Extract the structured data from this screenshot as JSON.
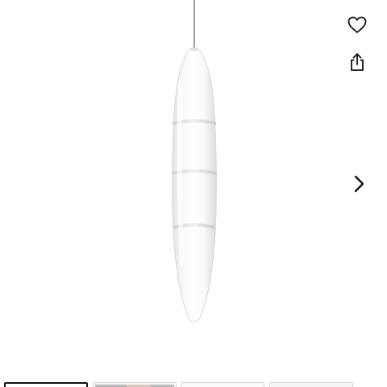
{
  "product_gallery": {
    "image_name": "pendant-lamp",
    "icons": {
      "favorite": "heart-icon",
      "share": "share-icon",
      "next": "chevron-right-icon"
    },
    "thumbnails": [
      {
        "name": "thumb-1",
        "active": true
      },
      {
        "name": "thumb-2",
        "active": false
      },
      {
        "name": "thumb-3",
        "active": false
      },
      {
        "name": "thumb-4",
        "active": false
      }
    ],
    "colors": {
      "icon": "#111111",
      "cord": "#9a9a9a",
      "shade_light": "#ffffff",
      "shade_shadow": "#d9d9d9",
      "thumb_active_border": "#111111"
    }
  }
}
